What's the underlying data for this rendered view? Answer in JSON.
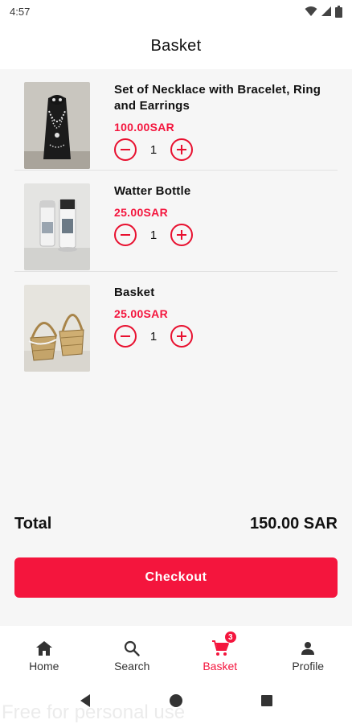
{
  "status_bar": {
    "time": "4:57"
  },
  "header": {
    "title": "Basket"
  },
  "cart": {
    "items": [
      {
        "name": "Set of Necklace with Bracelet, Ring and Earrings",
        "price": "100.00SAR",
        "quantity": "1",
        "image": "necklace-set-photo"
      },
      {
        "name": "Watter Bottle",
        "price": "25.00SAR",
        "quantity": "1",
        "image": "water-bottle-photo"
      },
      {
        "name": "Basket",
        "price": "25.00SAR",
        "quantity": "1",
        "image": "basket-photo"
      }
    ]
  },
  "summary": {
    "total_label": "Total",
    "total_value": "150.00 SAR"
  },
  "checkout": {
    "label": "Checkout"
  },
  "bottom_nav": {
    "items": [
      {
        "label": "Home",
        "icon": "home-icon"
      },
      {
        "label": "Search",
        "icon": "search-icon"
      },
      {
        "label": "Basket",
        "icon": "cart-icon",
        "badge": "3",
        "active": true
      },
      {
        "label": "Profile",
        "icon": "person-icon"
      }
    ]
  },
  "colors": {
    "accent": "#f4153d",
    "background": "#f6f6f6",
    "surface": "#ffffff"
  },
  "watermark": "Free for personal use"
}
